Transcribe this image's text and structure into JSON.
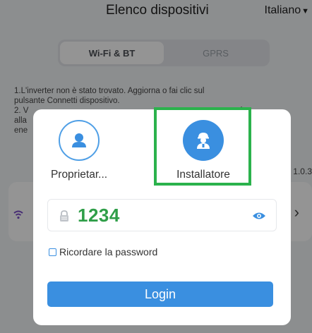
{
  "header": {
    "title": "Elenco dispositivi",
    "language": "Italiano"
  },
  "connection_tabs": [
    {
      "label": "Wi-Fi & BT",
      "active": true
    },
    {
      "label": "GPRS",
      "active": false
    }
  ],
  "background": {
    "info_line1": "1.L'inverter non è stato trovato. Aggiorna o fai clic sul",
    "info_line2": "pulsante Connetti dispositivo.",
    "info_line3": "2. V                                                                                         gati",
    "info_line4": "alla",
    "info_line5": "ene",
    "version": "1.0.3"
  },
  "login_modal": {
    "roles": [
      {
        "label": "Proprietar...",
        "icon": "user-icon",
        "selected": false
      },
      {
        "label": "Installatore",
        "icon": "installer-icon",
        "selected": true
      }
    ],
    "password": {
      "value": "1234"
    },
    "remember_label": "Ricordare la password",
    "remember_checked": false,
    "login_label": "Login"
  },
  "colors": {
    "accent": "#3a8fe0",
    "highlight": "#2bb24c",
    "password_text": "#2f9e48"
  }
}
